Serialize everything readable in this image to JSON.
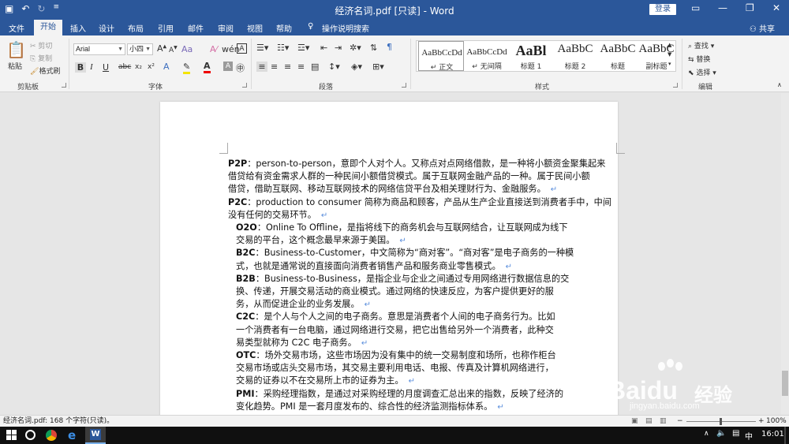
{
  "window": {
    "title": "经济名词.pdf [只读] - Word",
    "login": "登录",
    "share": "共享"
  },
  "tabs": [
    "文件",
    "开始",
    "插入",
    "设计",
    "布局",
    "引用",
    "邮件",
    "审阅",
    "视图",
    "帮助",
    "操作说明搜索"
  ],
  "clipboard": {
    "paste": "粘贴",
    "cut": "剪切",
    "copy": "复制",
    "format_painter": "格式刷",
    "label": "剪贴板"
  },
  "font": {
    "name": "Arial",
    "size": "小四",
    "grow": "A",
    "shrink": "A",
    "label": "字体"
  },
  "paragraph": {
    "label": "段落"
  },
  "styles": {
    "label": "样式",
    "items": [
      {
        "sample": "AaBbCcDd",
        "name": "↵ 正文"
      },
      {
        "sample": "AaBbCcDd",
        "name": "↵ 无间隔"
      },
      {
        "sample": "AaBl",
        "name": "标题 1"
      },
      {
        "sample": "AaBbC",
        "name": "标题 2"
      },
      {
        "sample": "AaBbC",
        "name": "标题"
      },
      {
        "sample": "AaBbC",
        "name": "副标题"
      }
    ]
  },
  "editing": {
    "find": "查找",
    "replace": "替换",
    "select": "选择",
    "label": "编辑"
  },
  "document": {
    "lines": [
      {
        "pre": "",
        "bold": "P2P",
        "text": "：person-to-person，意即个人对个人。又称点对点网络借款，是一种将小额资金聚集起来",
        "pm": false,
        "ind": false
      },
      {
        "pre": "",
        "bold": "",
        "text": "借贷给有资金需求人群的一种民间小额借贷模式。属于互联网金融产品的一种。属于民间小额",
        "pm": false,
        "ind": false
      },
      {
        "pre": "",
        "bold": "",
        "text": "借贷，借助互联网、移动互联网技术的网络信贷平台及相关理财行为、金融服务。",
        "pm": true,
        "ind": false
      },
      {
        "pre": "",
        "bold": "P2C",
        "text": "：production to consumer 简称为商品和顾客，产品从生产企业直接送到消费者手中，中间",
        "pm": false,
        "ind": false
      },
      {
        "pre": "",
        "bold": "",
        "text": "没有任何的交易环节。",
        "pm": true,
        "ind": false
      },
      {
        "pre": "",
        "bold": "O2O",
        "text": "：Online To Offline，是指将线下的商务机会与互联网结合，让互联网成为线下",
        "pm": false,
        "ind": true
      },
      {
        "pre": "",
        "bold": "",
        "text": "交易的平台，这个概念最早来源于美国。",
        "pm": true,
        "ind": true
      },
      {
        "pre": "",
        "bold": "B2C",
        "text": "：Business-to-Customer，中文简称为“商对客”。“商对客”是电子商务的一种模",
        "pm": false,
        "ind": true
      },
      {
        "pre": "",
        "bold": "",
        "text": "式，也就是通常说的直接面向消费者销售产品和服务商业零售模式。",
        "pm": true,
        "ind": true
      },
      {
        "pre": "",
        "bold": "B2B",
        "text": "：Business-to-Business，是指企业与企业之间通过专用网络进行数据信息的交",
        "pm": false,
        "ind": true
      },
      {
        "pre": "",
        "bold": "",
        "text": "换、传递，开展交易活动的商业模式。通过网络的快速反应，为客户提供更好的服",
        "pm": false,
        "ind": true
      },
      {
        "pre": "",
        "bold": "",
        "text": "务，从而促进企业的业务发展。",
        "pm": true,
        "ind": true
      },
      {
        "pre": "",
        "bold": "C2C",
        "text": "：是个人与个人之间的电子商务。意思是消费者个人间的电子商务行为。比如",
        "pm": false,
        "ind": true
      },
      {
        "pre": "",
        "bold": "",
        "text": "一个消费者有一台电脑，通过网络进行交易，把它出售给另外一个消费者，此种交",
        "pm": false,
        "ind": true
      },
      {
        "pre": "",
        "bold": "",
        "text": "易类型就称为  C2C 电子商务。",
        "pm": true,
        "ind": true
      },
      {
        "pre": "",
        "bold": "OTC",
        "text": "：场外交易市场，这些市场因为没有集中的统一交易制度和场所，也称作柜台",
        "pm": false,
        "ind": true
      },
      {
        "pre": "",
        "bold": "",
        "text": "交易市场或店头交易市场，其交易主要利用电话、电报、传真及计算机网络进行，",
        "pm": false,
        "ind": true
      },
      {
        "pre": "",
        "bold": "",
        "text": "交易的证券以不在交易所上市的证券为主。",
        "pm": true,
        "ind": true
      },
      {
        "pre": "",
        "bold": "PMI",
        "text": "：采购经理指数，是通过对采购经理的月度调查汇总出来的指数，反映了经济的",
        "pm": false,
        "ind": true
      },
      {
        "pre": "",
        "bold": "",
        "text": "变化趋势。PMI 是一套月度发布的、综合性的经济监测指标体系。",
        "pm": true,
        "ind": true
      }
    ]
  },
  "status": {
    "left": "经济名词.pdf: 168 个字符(只读)。",
    "zoom": "100%"
  },
  "taskbar": {
    "time": "16:01",
    "lang": "中"
  },
  "watermark": {
    "brand": "Baidu",
    "brand_cn": "经验",
    "url": "jingyan.baidu.com"
  }
}
